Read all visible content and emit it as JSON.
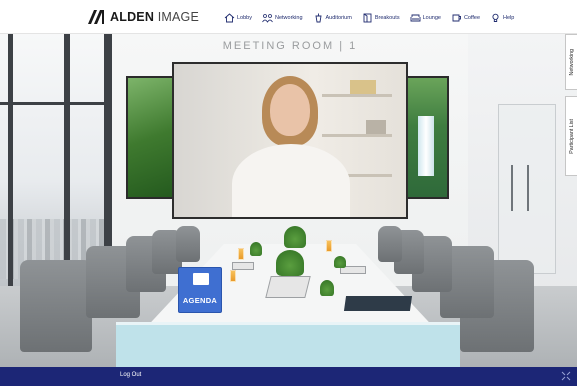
{
  "brand": {
    "logo_text": "ALDEN",
    "logo_text_light": " IMAGE",
    "logo_icon": "alden-logo-mark"
  },
  "nav": {
    "items": [
      {
        "label": "Lobby",
        "icon": "house-icon"
      },
      {
        "label": "Networking",
        "icon": "people-icon"
      },
      {
        "label": "Auditorium",
        "icon": "podium-icon"
      },
      {
        "label": "Breakouts",
        "icon": "breakout-icon"
      },
      {
        "label": "Lounge",
        "icon": "sofa-icon"
      },
      {
        "label": "Coffee",
        "icon": "cup-icon"
      },
      {
        "label": "Help",
        "icon": "bulb-icon"
      }
    ]
  },
  "room": {
    "title": "MEETING ROOM | 1"
  },
  "agenda": {
    "label": "AGENDA",
    "icon": "calendar-icon"
  },
  "side_tabs": {
    "networking": "Networking",
    "participant_list": "Participant List"
  },
  "footer": {
    "logout_label": "Log Out",
    "icon": "expand-icon"
  },
  "colors": {
    "brand_navy": "#1c2676",
    "agenda_blue": "#3f6fd1",
    "table_front": "#bfe2ea"
  }
}
